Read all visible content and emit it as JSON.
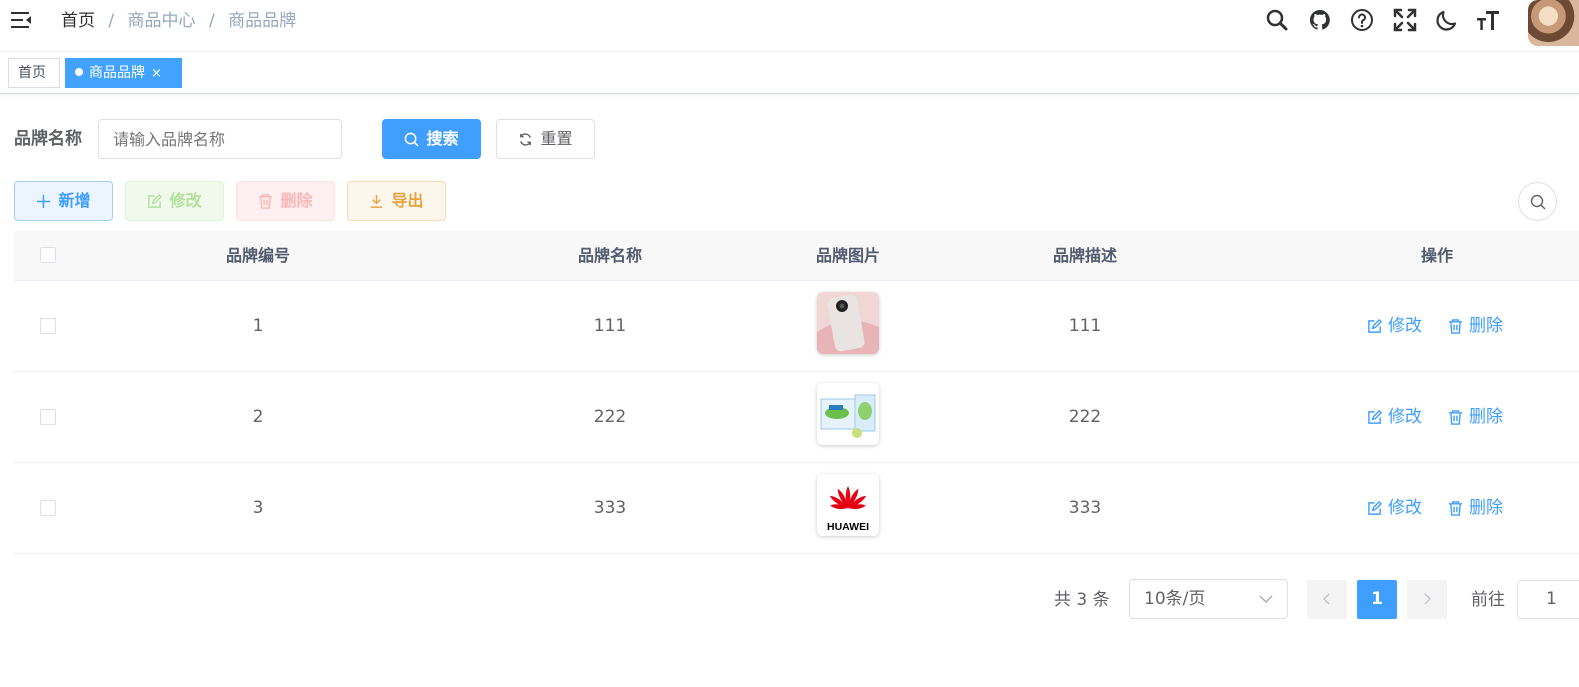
{
  "breadcrumb": {
    "home": "首页",
    "sep": "/",
    "items": [
      "商品中心",
      "商品品牌"
    ]
  },
  "tags": {
    "home": "首页",
    "active": "商品品牌",
    "close": "×"
  },
  "search": {
    "label": "品牌名称",
    "placeholder": "请输入品牌名称",
    "search_label": "搜索",
    "reset_label": "重置"
  },
  "toolbar": {
    "add_label": "新增",
    "edit_label": "修改",
    "delete_label": "删除",
    "export_label": "导出"
  },
  "table": {
    "columns": [
      "品牌编号",
      "品牌名称",
      "品牌图片",
      "品牌描述",
      "操作"
    ],
    "rows": [
      {
        "id": "1",
        "name": "111",
        "image": "phone-image",
        "desc": "111",
        "edit": "修改",
        "delete": "删除"
      },
      {
        "id": "2",
        "name": "222",
        "image": "tissue-pack-image",
        "desc": "222",
        "edit": "修改",
        "delete": "删除"
      },
      {
        "id": "3",
        "name": "333",
        "image": "huawei-logo",
        "desc": "333",
        "edit": "修改",
        "delete": "删除"
      }
    ]
  },
  "huawei_text": "HUAWEI",
  "pagination": {
    "total": "共 3 条",
    "page_size": "10条/页",
    "current": "1",
    "goto_label": "前往",
    "goto_value": "1"
  },
  "colors": {
    "primary": "#409eff",
    "tag_active": "#42a2ff",
    "success_light": "#b3e19d",
    "danger_light": "#fab6b6",
    "warning": "#e6a23c"
  }
}
